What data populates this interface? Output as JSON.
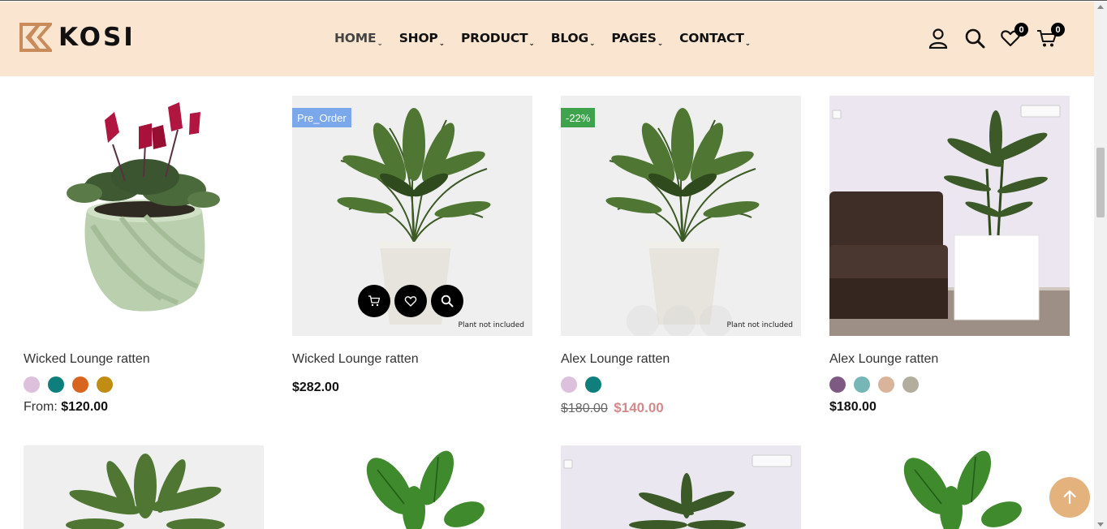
{
  "brand": {
    "name": "KOSI"
  },
  "nav": [
    {
      "label": "HOME",
      "active": true
    },
    {
      "label": "SHOP"
    },
    {
      "label": "PRODUCT"
    },
    {
      "label": "BLOG"
    },
    {
      "label": "PAGES"
    },
    {
      "label": "CONTACT"
    }
  ],
  "header_icons": {
    "account": "user-icon",
    "search": "search-icon",
    "wishlist": "heart-icon",
    "wishlist_count": "0",
    "cart": "cart-icon",
    "cart_count": "0"
  },
  "products": [
    {
      "title": "Wicked Lounge ratten",
      "swatches": [
        "#dcc0dc",
        "#0e7f7d",
        "#d8641f",
        "#c18c12"
      ],
      "price_prefix": "From:",
      "price": "$120.00"
    },
    {
      "title": "Wicked Lounge ratten",
      "badge": "Pre_Order",
      "note": "Plant not included",
      "price": "$282.00",
      "hover_actions": [
        "add-to-cart",
        "add-to-wishlist",
        "quick-view"
      ]
    },
    {
      "title": "Alex Lounge ratten",
      "badge": "-22%",
      "note": "Plant not included",
      "swatches": [
        "#dcc0dc",
        "#0e7f7d"
      ],
      "old_price": "$180.00",
      "price": "$140.00"
    },
    {
      "title": "Alex Lounge ratten",
      "swatches": [
        "#7d5a82",
        "#77b6b6",
        "#d9b49a",
        "#b2ad9c"
      ],
      "price": "$180.00"
    }
  ],
  "colors": {
    "header_bg": "#fae6d0",
    "brand_accent": "#c98b5a",
    "badge_preorder": "#7aa8ea",
    "badge_sale": "#3fa34d",
    "sale_price": "#d48a8a",
    "back_to_top": "#e3b27d"
  }
}
